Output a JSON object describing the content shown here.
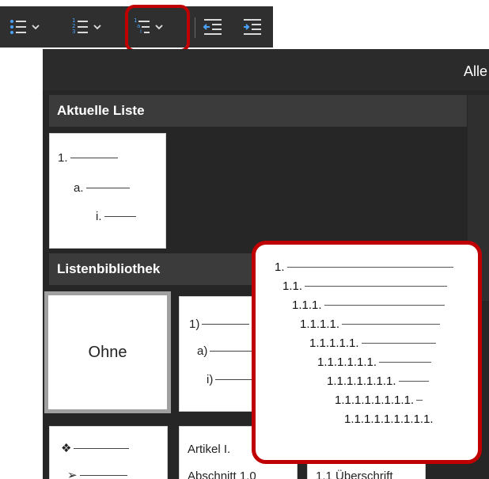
{
  "toolbar": {
    "buttons": [
      {
        "name": "bullets-button",
        "icon": "bullet-list-icon"
      },
      {
        "name": "numbering-button",
        "icon": "numbered-list-icon"
      },
      {
        "name": "multilevel-list-button",
        "icon": "multilevel-list-icon"
      },
      {
        "name": "decrease-indent-button",
        "icon": "decrease-indent-icon"
      },
      {
        "name": "increase-indent-button",
        "icon": "increase-indent-icon"
      }
    ],
    "highlight_color": "#c00000",
    "icon_accent_color": "#4aa3ff"
  },
  "gallery": {
    "filter_label": "Alle",
    "current_section_label": "Aktuelle Liste",
    "current_list": [
      "1.",
      "a.",
      "i."
    ],
    "library_section_label": "Listenbibliothek",
    "library": {
      "none_label": "Ohne",
      "paren_list": [
        "1)",
        "a)",
        "i)"
      ],
      "symbol_list": [
        "❖",
        "➢"
      ],
      "heading_list": [
        "Artikel I.",
        "Abschnitt 1.0"
      ],
      "third_list": [
        "1.1 Überschrift"
      ]
    }
  },
  "callout": {
    "levels": [
      "1.",
      "1.1.",
      "1.1.1.",
      "1.1.1.1.",
      "1.1.1.1.1.",
      "1.1.1.1.1.1.",
      "1.1.1.1.1.1.1.",
      "1.1.1.1.1.1.1.1.",
      "1.1.1.1.1.1.1.1.1."
    ],
    "border_color": "#c00000"
  }
}
